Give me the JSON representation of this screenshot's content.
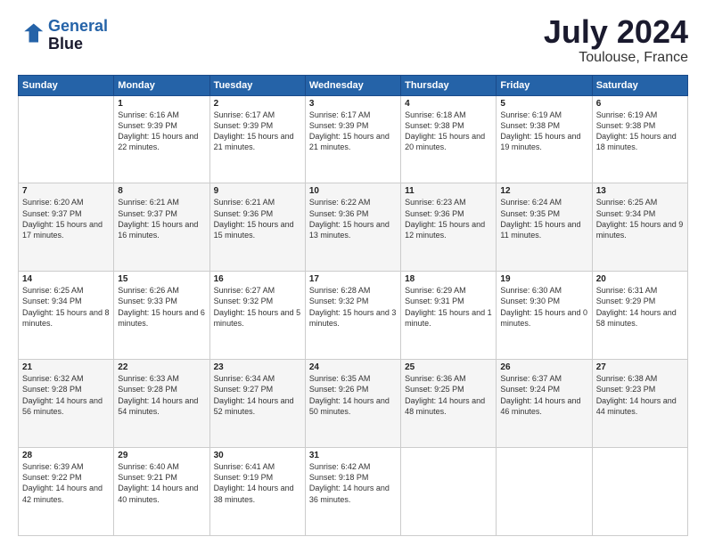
{
  "logo": {
    "line1": "General",
    "line2": "Blue"
  },
  "title": "July 2024",
  "location": "Toulouse, France",
  "days": [
    "Sunday",
    "Monday",
    "Tuesday",
    "Wednesday",
    "Thursday",
    "Friday",
    "Saturday"
  ],
  "weeks": [
    [
      {
        "num": "",
        "text": ""
      },
      {
        "num": "1",
        "text": "Sunrise: 6:16 AM\nSunset: 9:39 PM\nDaylight: 15 hours\nand 22 minutes."
      },
      {
        "num": "2",
        "text": "Sunrise: 6:17 AM\nSunset: 9:39 PM\nDaylight: 15 hours\nand 21 minutes."
      },
      {
        "num": "3",
        "text": "Sunrise: 6:17 AM\nSunset: 9:39 PM\nDaylight: 15 hours\nand 21 minutes."
      },
      {
        "num": "4",
        "text": "Sunrise: 6:18 AM\nSunset: 9:38 PM\nDaylight: 15 hours\nand 20 minutes."
      },
      {
        "num": "5",
        "text": "Sunrise: 6:19 AM\nSunset: 9:38 PM\nDaylight: 15 hours\nand 19 minutes."
      },
      {
        "num": "6",
        "text": "Sunrise: 6:19 AM\nSunset: 9:38 PM\nDaylight: 15 hours\nand 18 minutes."
      }
    ],
    [
      {
        "num": "7",
        "text": "Sunrise: 6:20 AM\nSunset: 9:37 PM\nDaylight: 15 hours\nand 17 minutes."
      },
      {
        "num": "8",
        "text": "Sunrise: 6:21 AM\nSunset: 9:37 PM\nDaylight: 15 hours\nand 16 minutes."
      },
      {
        "num": "9",
        "text": "Sunrise: 6:21 AM\nSunset: 9:36 PM\nDaylight: 15 hours\nand 15 minutes."
      },
      {
        "num": "10",
        "text": "Sunrise: 6:22 AM\nSunset: 9:36 PM\nDaylight: 15 hours\nand 13 minutes."
      },
      {
        "num": "11",
        "text": "Sunrise: 6:23 AM\nSunset: 9:36 PM\nDaylight: 15 hours\nand 12 minutes."
      },
      {
        "num": "12",
        "text": "Sunrise: 6:24 AM\nSunset: 9:35 PM\nDaylight: 15 hours\nand 11 minutes."
      },
      {
        "num": "13",
        "text": "Sunrise: 6:25 AM\nSunset: 9:34 PM\nDaylight: 15 hours\nand 9 minutes."
      }
    ],
    [
      {
        "num": "14",
        "text": "Sunrise: 6:25 AM\nSunset: 9:34 PM\nDaylight: 15 hours\nand 8 minutes."
      },
      {
        "num": "15",
        "text": "Sunrise: 6:26 AM\nSunset: 9:33 PM\nDaylight: 15 hours\nand 6 minutes."
      },
      {
        "num": "16",
        "text": "Sunrise: 6:27 AM\nSunset: 9:32 PM\nDaylight: 15 hours\nand 5 minutes."
      },
      {
        "num": "17",
        "text": "Sunrise: 6:28 AM\nSunset: 9:32 PM\nDaylight: 15 hours\nand 3 minutes."
      },
      {
        "num": "18",
        "text": "Sunrise: 6:29 AM\nSunset: 9:31 PM\nDaylight: 15 hours\nand 1 minute."
      },
      {
        "num": "19",
        "text": "Sunrise: 6:30 AM\nSunset: 9:30 PM\nDaylight: 15 hours\nand 0 minutes."
      },
      {
        "num": "20",
        "text": "Sunrise: 6:31 AM\nSunset: 9:29 PM\nDaylight: 14 hours\nand 58 minutes."
      }
    ],
    [
      {
        "num": "21",
        "text": "Sunrise: 6:32 AM\nSunset: 9:28 PM\nDaylight: 14 hours\nand 56 minutes."
      },
      {
        "num": "22",
        "text": "Sunrise: 6:33 AM\nSunset: 9:28 PM\nDaylight: 14 hours\nand 54 minutes."
      },
      {
        "num": "23",
        "text": "Sunrise: 6:34 AM\nSunset: 9:27 PM\nDaylight: 14 hours\nand 52 minutes."
      },
      {
        "num": "24",
        "text": "Sunrise: 6:35 AM\nSunset: 9:26 PM\nDaylight: 14 hours\nand 50 minutes."
      },
      {
        "num": "25",
        "text": "Sunrise: 6:36 AM\nSunset: 9:25 PM\nDaylight: 14 hours\nand 48 minutes."
      },
      {
        "num": "26",
        "text": "Sunrise: 6:37 AM\nSunset: 9:24 PM\nDaylight: 14 hours\nand 46 minutes."
      },
      {
        "num": "27",
        "text": "Sunrise: 6:38 AM\nSunset: 9:23 PM\nDaylight: 14 hours\nand 44 minutes."
      }
    ],
    [
      {
        "num": "28",
        "text": "Sunrise: 6:39 AM\nSunset: 9:22 PM\nDaylight: 14 hours\nand 42 minutes."
      },
      {
        "num": "29",
        "text": "Sunrise: 6:40 AM\nSunset: 9:21 PM\nDaylight: 14 hours\nand 40 minutes."
      },
      {
        "num": "30",
        "text": "Sunrise: 6:41 AM\nSunset: 9:19 PM\nDaylight: 14 hours\nand 38 minutes."
      },
      {
        "num": "31",
        "text": "Sunrise: 6:42 AM\nSunset: 9:18 PM\nDaylight: 14 hours\nand 36 minutes."
      },
      {
        "num": "",
        "text": ""
      },
      {
        "num": "",
        "text": ""
      },
      {
        "num": "",
        "text": ""
      }
    ]
  ]
}
